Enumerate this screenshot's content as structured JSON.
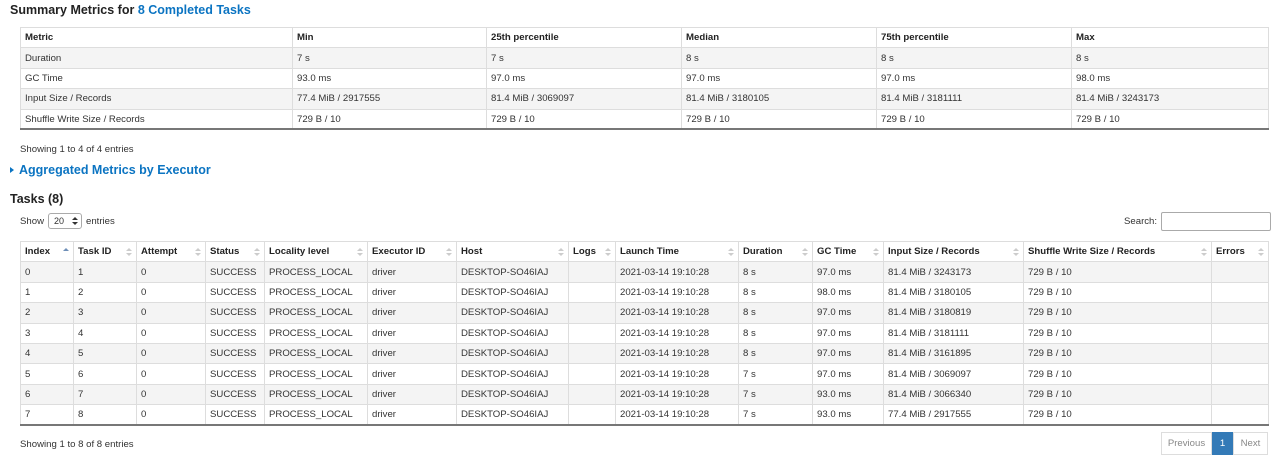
{
  "summary": {
    "title_prefix": "Summary Metrics for ",
    "title_link": "8 Completed Tasks",
    "headers": [
      "Metric",
      "Min",
      "25th percentile",
      "Median",
      "75th percentile",
      "Max"
    ],
    "rows": [
      [
        "Duration",
        "7 s",
        "7 s",
        "8 s",
        "8 s",
        "8 s"
      ],
      [
        "GC Time",
        "93.0 ms",
        "97.0 ms",
        "97.0 ms",
        "97.0 ms",
        "98.0 ms"
      ],
      [
        "Input Size / Records",
        "77.4 MiB / 2917555",
        "81.4 MiB / 3069097",
        "81.4 MiB / 3180105",
        "81.4 MiB / 3181111",
        "81.4 MiB / 3243173"
      ],
      [
        "Shuffle Write Size / Records",
        "729 B / 10",
        "729 B / 10",
        "729 B / 10",
        "729 B / 10",
        "729 B / 10"
      ]
    ],
    "showing": "Showing 1 to 4 of 4 entries"
  },
  "aggregated": {
    "label": "Aggregated Metrics by Executor"
  },
  "tasks": {
    "title": "Tasks (8)",
    "show_label": "Show",
    "page_size": "20",
    "entries_label": "entries",
    "search_label": "Search:",
    "search_value": "",
    "headers": [
      "Index",
      "Task ID",
      "Attempt",
      "Status",
      "Locality level",
      "Executor ID",
      "Host",
      "Logs",
      "Launch Time",
      "Duration",
      "GC Time",
      "Input Size / Records",
      "Shuffle Write Size / Records",
      "Errors"
    ],
    "rows": [
      [
        "0",
        "1",
        "0",
        "SUCCESS",
        "PROCESS_LOCAL",
        "driver",
        "DESKTOP-SO46IAJ",
        "",
        "2021-03-14 19:10:28",
        "8 s",
        "97.0 ms",
        "81.4 MiB / 3243173",
        "729 B / 10",
        ""
      ],
      [
        "1",
        "2",
        "0",
        "SUCCESS",
        "PROCESS_LOCAL",
        "driver",
        "DESKTOP-SO46IAJ",
        "",
        "2021-03-14 19:10:28",
        "8 s",
        "98.0 ms",
        "81.4 MiB / 3180105",
        "729 B / 10",
        ""
      ],
      [
        "2",
        "3",
        "0",
        "SUCCESS",
        "PROCESS_LOCAL",
        "driver",
        "DESKTOP-SO46IAJ",
        "",
        "2021-03-14 19:10:28",
        "8 s",
        "97.0 ms",
        "81.4 MiB / 3180819",
        "729 B / 10",
        ""
      ],
      [
        "3",
        "4",
        "0",
        "SUCCESS",
        "PROCESS_LOCAL",
        "driver",
        "DESKTOP-SO46IAJ",
        "",
        "2021-03-14 19:10:28",
        "8 s",
        "97.0 ms",
        "81.4 MiB / 3181111",
        "729 B / 10",
        ""
      ],
      [
        "4",
        "5",
        "0",
        "SUCCESS",
        "PROCESS_LOCAL",
        "driver",
        "DESKTOP-SO46IAJ",
        "",
        "2021-03-14 19:10:28",
        "8 s",
        "97.0 ms",
        "81.4 MiB / 3161895",
        "729 B / 10",
        ""
      ],
      [
        "5",
        "6",
        "0",
        "SUCCESS",
        "PROCESS_LOCAL",
        "driver",
        "DESKTOP-SO46IAJ",
        "",
        "2021-03-14 19:10:28",
        "7 s",
        "97.0 ms",
        "81.4 MiB / 3069097",
        "729 B / 10",
        ""
      ],
      [
        "6",
        "7",
        "0",
        "SUCCESS",
        "PROCESS_LOCAL",
        "driver",
        "DESKTOP-SO46IAJ",
        "",
        "2021-03-14 19:10:28",
        "7 s",
        "93.0 ms",
        "81.4 MiB / 3066340",
        "729 B / 10",
        ""
      ],
      [
        "7",
        "8",
        "0",
        "SUCCESS",
        "PROCESS_LOCAL",
        "driver",
        "DESKTOP-SO46IAJ",
        "",
        "2021-03-14 19:10:28",
        "7 s",
        "93.0 ms",
        "77.4 MiB / 2917555",
        "729 B / 10",
        ""
      ]
    ],
    "showing": "Showing 1 to 8 of 8 entries"
  },
  "pagination": {
    "previous": "Previous",
    "current": "1",
    "next": "Next"
  },
  "colors": {
    "link": "#0b74c2",
    "active_page": "#337ab7",
    "stripe": "#f4f4f4"
  }
}
